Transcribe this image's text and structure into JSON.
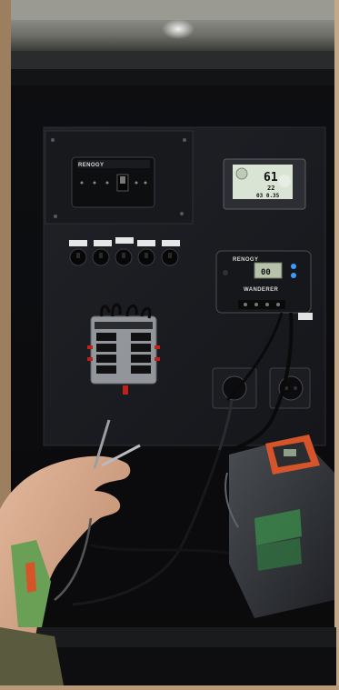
{
  "photo": {
    "subject": "",
    "colors": {
      "frame_wood": "#b89a78",
      "cabinet_dark": "#141416",
      "panel_board": "#1b1c20",
      "accent_orange": "#d6542a",
      "fuse_red": "#c0201a",
      "lcd_bg": "#d9e4d5",
      "led_blue": "#3a9cff"
    }
  },
  "dc_controller": {
    "brand": "RENOGY"
  },
  "battery_monitor": {
    "reading_main": "61",
    "reading_secondary": "22",
    "reading_bottom": "03 0.35"
  },
  "charge_controller": {
    "brand": "RENOGY",
    "model": "WANDERER",
    "lcd_value": "00"
  },
  "switch_panel": {
    "labels": [
      "",
      "",
      "",
      "",
      ""
    ]
  }
}
